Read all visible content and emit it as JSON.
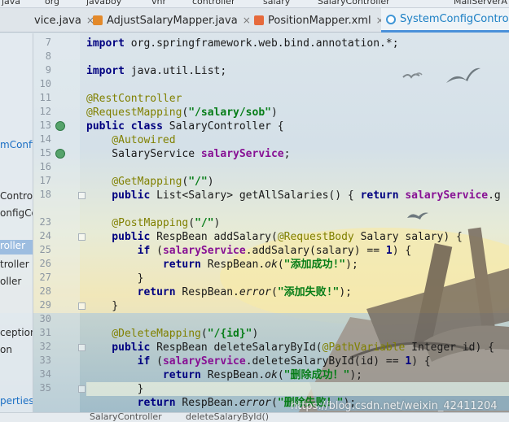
{
  "breadcrumb": [
    "java",
    "org",
    "javaboy",
    "vhr",
    "controller",
    "salary",
    "SalaryController",
    "MailServerA"
  ],
  "tabs": [
    {
      "label": "vice.java",
      "icon": "java-file-icon",
      "active": false
    },
    {
      "label": "AdjustSalaryMapper.java",
      "icon": "java-file-icon",
      "active": false
    },
    {
      "label": "PositionMapper.xml",
      "icon": "xml-file-icon",
      "active": false
    },
    {
      "label": "SystemConfigController",
      "icon": "class-icon",
      "active": true
    }
  ],
  "left_panel": {
    "items": [
      {
        "label": "mConfig",
        "state": "blue"
      },
      {
        "label": "Contro",
        "state": "normal"
      },
      {
        "label": "onfigCo",
        "state": "normal"
      },
      {
        "label": "roller",
        "state": "selected"
      },
      {
        "label": "troller",
        "state": "normal"
      },
      {
        "label": "oller",
        "state": "normal"
      },
      {
        "label": "ception",
        "state": "normal"
      },
      {
        "label": "on",
        "state": "normal"
      },
      {
        "label": "perties",
        "state": "blue"
      }
    ]
  },
  "gutter": {
    "line_numbers": [
      "7",
      "8",
      "9",
      "10",
      "11",
      "12",
      "13",
      "14",
      "15",
      "16",
      "17",
      "18",
      "23",
      "24",
      "25",
      "26",
      "27",
      "28",
      "29",
      "30",
      "31",
      "32",
      "33",
      "34",
      "35"
    ]
  },
  "code_lines": [
    [
      {
        "t": "import",
        "c": "kw"
      },
      {
        "t": " org.springframework.web.bind.annotation.*;",
        "c": ""
      }
    ],
    [],
    [
      {
        "t": "import",
        "c": "kw"
      },
      {
        "t": " java.util.List;",
        "c": ""
      }
    ],
    [],
    [
      {
        "t": "@RestController",
        "c": "ann"
      }
    ],
    [
      {
        "t": "@RequestMapping",
        "c": "ann"
      },
      {
        "t": "(",
        "c": ""
      },
      {
        "t": "\"/salary/sob\"",
        "c": "str"
      },
      {
        "t": ")",
        "c": ""
      }
    ],
    [
      {
        "t": "public class",
        "c": "kw"
      },
      {
        "t": " SalaryController {",
        "c": ""
      }
    ],
    [
      {
        "t": "    @Autowired",
        "c": "ann"
      }
    ],
    [
      {
        "t": "    SalaryService ",
        "c": ""
      },
      {
        "t": "salaryService",
        "c": "fld"
      },
      {
        "t": ";",
        "c": ""
      }
    ],
    [],
    [
      {
        "t": "    @GetMapping",
        "c": "ann"
      },
      {
        "t": "(",
        "c": ""
      },
      {
        "t": "\"/\"",
        "c": "str"
      },
      {
        "t": ")",
        "c": ""
      }
    ],
    [
      {
        "t": "    public",
        "c": "kw"
      },
      {
        "t": " List<Salary> getAllSalaries() { ",
        "c": ""
      },
      {
        "t": "return",
        "c": "kw"
      },
      {
        "t": " ",
        "c": ""
      },
      {
        "t": "salaryService",
        "c": "fld"
      },
      {
        "t": ".g",
        "c": ""
      }
    ],
    [],
    [
      {
        "t": "    @PostMapping",
        "c": "ann"
      },
      {
        "t": "(",
        "c": ""
      },
      {
        "t": "\"/\"",
        "c": "str"
      },
      {
        "t": ")",
        "c": ""
      }
    ],
    [
      {
        "t": "    public",
        "c": "kw"
      },
      {
        "t": " RespBean addSalary(",
        "c": ""
      },
      {
        "t": "@RequestBody",
        "c": "ann"
      },
      {
        "t": " Salary salary) {",
        "c": ""
      }
    ],
    [
      {
        "t": "        if",
        "c": "kw"
      },
      {
        "t": " (",
        "c": ""
      },
      {
        "t": "salaryService",
        "c": "fld"
      },
      {
        "t": ".addSalary(salary) == ",
        "c": ""
      },
      {
        "t": "1",
        "c": "kw"
      },
      {
        "t": ") {",
        "c": ""
      }
    ],
    [
      {
        "t": "            return",
        "c": "kw"
      },
      {
        "t": " RespBean.",
        "c": ""
      },
      {
        "t": "ok",
        "c": "italic"
      },
      {
        "t": "(",
        "c": ""
      },
      {
        "t": "\"添加成功!\"",
        "c": "str"
      },
      {
        "t": ");",
        "c": ""
      }
    ],
    [
      {
        "t": "        }",
        "c": ""
      }
    ],
    [
      {
        "t": "        return",
        "c": "kw"
      },
      {
        "t": " RespBean.",
        "c": ""
      },
      {
        "t": "error",
        "c": "italic"
      },
      {
        "t": "(",
        "c": ""
      },
      {
        "t": "\"添加失败!\"",
        "c": "str"
      },
      {
        "t": ");",
        "c": ""
      }
    ],
    [
      {
        "t": "    }",
        "c": ""
      }
    ],
    [],
    [
      {
        "t": "    @DeleteMapping",
        "c": "ann"
      },
      {
        "t": "(",
        "c": ""
      },
      {
        "t": "\"/{id}\"",
        "c": "str"
      },
      {
        "t": ")",
        "c": ""
      }
    ],
    [
      {
        "t": "    public",
        "c": "kw"
      },
      {
        "t": " RespBean deleteSalaryById(",
        "c": ""
      },
      {
        "t": "@PathVariable",
        "c": "ann"
      },
      {
        "t": " Integer id) {",
        "c": ""
      }
    ],
    [
      {
        "t": "        if",
        "c": "kw"
      },
      {
        "t": " (",
        "c": ""
      },
      {
        "t": "salaryService",
        "c": "fld"
      },
      {
        "t": ".deleteSalaryById(id) == ",
        "c": ""
      },
      {
        "t": "1",
        "c": "kw"
      },
      {
        "t": ") {",
        "c": ""
      }
    ],
    [
      {
        "t": "            return",
        "c": "kw"
      },
      {
        "t": " RespBean.",
        "c": ""
      },
      {
        "t": "ok",
        "c": "italic"
      },
      {
        "t": "(",
        "c": ""
      },
      {
        "t": "\"删除成功！\"",
        "c": "str"
      },
      {
        "t": ");",
        "c": ""
      }
    ],
    [
      {
        "t": "        }",
        "c": ""
      }
    ],
    [
      {
        "t": "        return",
        "c": "kw"
      },
      {
        "t": " RespBean.",
        "c": ""
      },
      {
        "t": "error",
        "c": "italic"
      },
      {
        "t": "(",
        "c": ""
      },
      {
        "t": "\"删除失败！\"",
        "c": "str"
      },
      {
        "t": ");",
        "c": ""
      }
    ]
  ],
  "status_bar": {
    "items": [
      "SalaryController",
      "deleteSalaryById()"
    ]
  },
  "watermark": "https://blog.csdn.net/weixin_42411204",
  "colors": {
    "keyword": "#000080",
    "annotation": "#808000",
    "string": "#067d17",
    "field": "#871094",
    "active_tab": "#1b7fc4"
  }
}
